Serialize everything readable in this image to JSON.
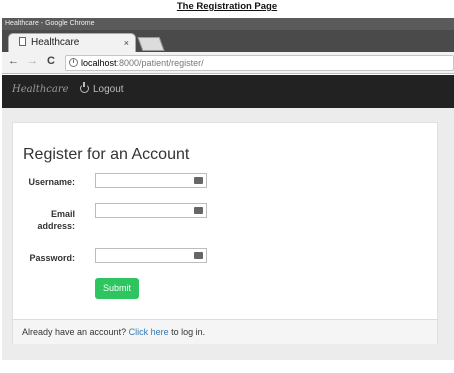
{
  "caption": "The Registration Page",
  "window": {
    "title": "Healthcare - Google Chrome"
  },
  "browser": {
    "tab_title": "Healthcare",
    "tab_close": "×",
    "back": "←",
    "forward": "→",
    "reload": "C",
    "url_host": "localhost",
    "url_path": ":8000/patient/register/"
  },
  "navbar": {
    "brand": "Healthcare",
    "logout": "Logout"
  },
  "form": {
    "title": "Register for an Account",
    "username_label": "Username:",
    "email_label_line1": "Email",
    "email_label_line2": "address:",
    "password_label": "Password:",
    "submit_label": "Submit",
    "username_value": "",
    "email_value": "",
    "password_value": ""
  },
  "footer": {
    "prefix": "Already have an account? ",
    "link": "Click here",
    "suffix": " to log in."
  },
  "colors": {
    "navbar": "#222222",
    "submit": "#2ec45f",
    "link": "#337ab7"
  }
}
